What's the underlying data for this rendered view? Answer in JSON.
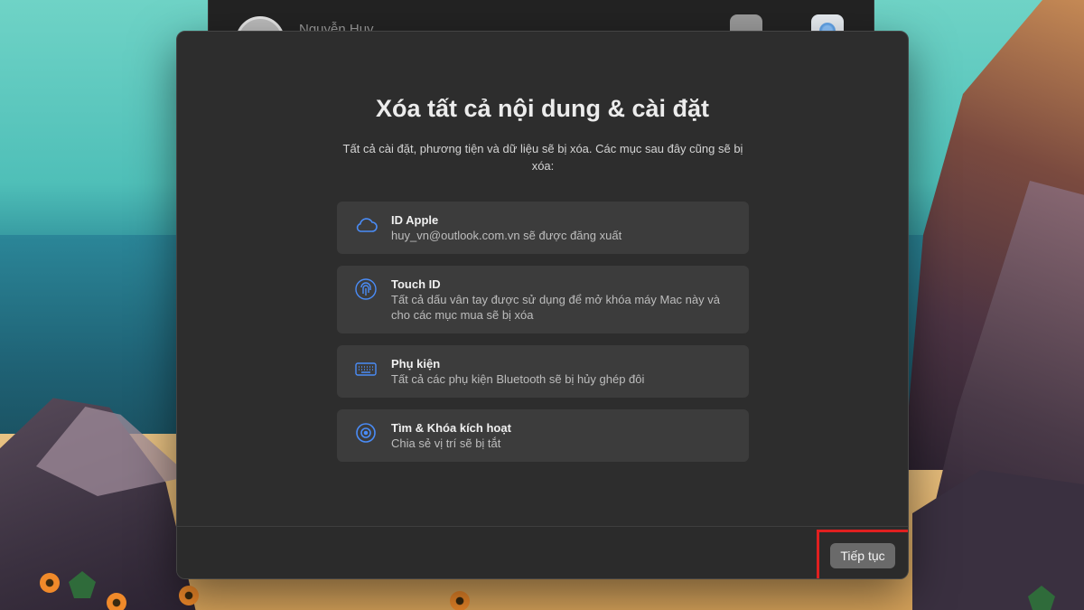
{
  "background_window": {
    "user_name": "Nguyễn Huy"
  },
  "dialog": {
    "title": "Xóa tất cả nội dung & cài đặt",
    "description": "Tất cả cài đặt, phương tiện và dữ liệu sẽ bị xóa. Các mục sau đây cũng sẽ bị xóa:",
    "items": [
      {
        "icon": "cloud-icon",
        "title": "ID Apple",
        "subtitle": "huy_vn@outlook.com.vn sẽ được đăng xuất"
      },
      {
        "icon": "fingerprint-icon",
        "title": "Touch ID",
        "subtitle": "Tất cả dấu vân tay được sử dụng để mở khóa máy Mac này và cho các mục mua sẽ bị xóa"
      },
      {
        "icon": "keyboard-icon",
        "title": "Phụ kiện",
        "subtitle": "Tất cả các phụ kiện Bluetooth sẽ bị hủy ghép đôi"
      },
      {
        "icon": "find-my-icon",
        "title": "Tìm & Khóa kích hoạt",
        "subtitle": "Chia sẻ vị trí sẽ bị tắt"
      }
    ],
    "continue_label": "Tiếp tục"
  },
  "colors": {
    "accent": "#4a8cf7",
    "highlight": "#e02020",
    "dialog_bg": "#2d2d2d"
  }
}
